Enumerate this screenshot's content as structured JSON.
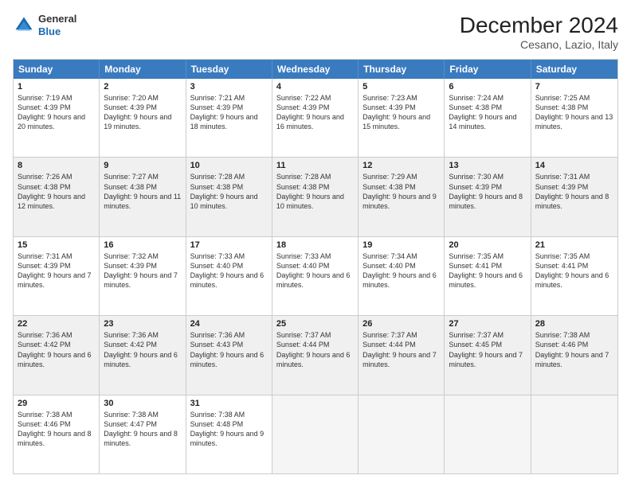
{
  "header": {
    "logo": {
      "general": "General",
      "blue": "Blue"
    },
    "title": "December 2024",
    "subtitle": "Cesano, Lazio, Italy"
  },
  "days": [
    "Sunday",
    "Monday",
    "Tuesday",
    "Wednesday",
    "Thursday",
    "Friday",
    "Saturday"
  ],
  "weeks": [
    [
      {
        "num": "1",
        "sunrise": "7:19 AM",
        "sunset": "4:39 PM",
        "daylight": "9 hours and 20 minutes."
      },
      {
        "num": "2",
        "sunrise": "7:20 AM",
        "sunset": "4:39 PM",
        "daylight": "9 hours and 19 minutes."
      },
      {
        "num": "3",
        "sunrise": "7:21 AM",
        "sunset": "4:39 PM",
        "daylight": "9 hours and 18 minutes."
      },
      {
        "num": "4",
        "sunrise": "7:22 AM",
        "sunset": "4:39 PM",
        "daylight": "9 hours and 16 minutes."
      },
      {
        "num": "5",
        "sunrise": "7:23 AM",
        "sunset": "4:39 PM",
        "daylight": "9 hours and 15 minutes."
      },
      {
        "num": "6",
        "sunrise": "7:24 AM",
        "sunset": "4:38 PM",
        "daylight": "9 hours and 14 minutes."
      },
      {
        "num": "7",
        "sunrise": "7:25 AM",
        "sunset": "4:38 PM",
        "daylight": "9 hours and 13 minutes."
      }
    ],
    [
      {
        "num": "8",
        "sunrise": "7:26 AM",
        "sunset": "4:38 PM",
        "daylight": "9 hours and 12 minutes."
      },
      {
        "num": "9",
        "sunrise": "7:27 AM",
        "sunset": "4:38 PM",
        "daylight": "9 hours and 11 minutes."
      },
      {
        "num": "10",
        "sunrise": "7:28 AM",
        "sunset": "4:38 PM",
        "daylight": "9 hours and 10 minutes."
      },
      {
        "num": "11",
        "sunrise": "7:28 AM",
        "sunset": "4:38 PM",
        "daylight": "9 hours and 10 minutes."
      },
      {
        "num": "12",
        "sunrise": "7:29 AM",
        "sunset": "4:38 PM",
        "daylight": "9 hours and 9 minutes."
      },
      {
        "num": "13",
        "sunrise": "7:30 AM",
        "sunset": "4:39 PM",
        "daylight": "9 hours and 8 minutes."
      },
      {
        "num": "14",
        "sunrise": "7:31 AM",
        "sunset": "4:39 PM",
        "daylight": "9 hours and 8 minutes."
      }
    ],
    [
      {
        "num": "15",
        "sunrise": "7:31 AM",
        "sunset": "4:39 PM",
        "daylight": "9 hours and 7 minutes."
      },
      {
        "num": "16",
        "sunrise": "7:32 AM",
        "sunset": "4:39 PM",
        "daylight": "9 hours and 7 minutes."
      },
      {
        "num": "17",
        "sunrise": "7:33 AM",
        "sunset": "4:40 PM",
        "daylight": "9 hours and 6 minutes."
      },
      {
        "num": "18",
        "sunrise": "7:33 AM",
        "sunset": "4:40 PM",
        "daylight": "9 hours and 6 minutes."
      },
      {
        "num": "19",
        "sunrise": "7:34 AM",
        "sunset": "4:40 PM",
        "daylight": "9 hours and 6 minutes."
      },
      {
        "num": "20",
        "sunrise": "7:35 AM",
        "sunset": "4:41 PM",
        "daylight": "9 hours and 6 minutes."
      },
      {
        "num": "21",
        "sunrise": "7:35 AM",
        "sunset": "4:41 PM",
        "daylight": "9 hours and 6 minutes."
      }
    ],
    [
      {
        "num": "22",
        "sunrise": "7:36 AM",
        "sunset": "4:42 PM",
        "daylight": "9 hours and 6 minutes."
      },
      {
        "num": "23",
        "sunrise": "7:36 AM",
        "sunset": "4:42 PM",
        "daylight": "9 hours and 6 minutes."
      },
      {
        "num": "24",
        "sunrise": "7:36 AM",
        "sunset": "4:43 PM",
        "daylight": "9 hours and 6 minutes."
      },
      {
        "num": "25",
        "sunrise": "7:37 AM",
        "sunset": "4:44 PM",
        "daylight": "9 hours and 6 minutes."
      },
      {
        "num": "26",
        "sunrise": "7:37 AM",
        "sunset": "4:44 PM",
        "daylight": "9 hours and 7 minutes."
      },
      {
        "num": "27",
        "sunrise": "7:37 AM",
        "sunset": "4:45 PM",
        "daylight": "9 hours and 7 minutes."
      },
      {
        "num": "28",
        "sunrise": "7:38 AM",
        "sunset": "4:46 PM",
        "daylight": "9 hours and 7 minutes."
      }
    ],
    [
      {
        "num": "29",
        "sunrise": "7:38 AM",
        "sunset": "4:46 PM",
        "daylight": "9 hours and 8 minutes."
      },
      {
        "num": "30",
        "sunrise": "7:38 AM",
        "sunset": "4:47 PM",
        "daylight": "9 hours and 8 minutes."
      },
      {
        "num": "31",
        "sunrise": "7:38 AM",
        "sunset": "4:48 PM",
        "daylight": "9 hours and 9 minutes."
      },
      null,
      null,
      null,
      null
    ]
  ]
}
